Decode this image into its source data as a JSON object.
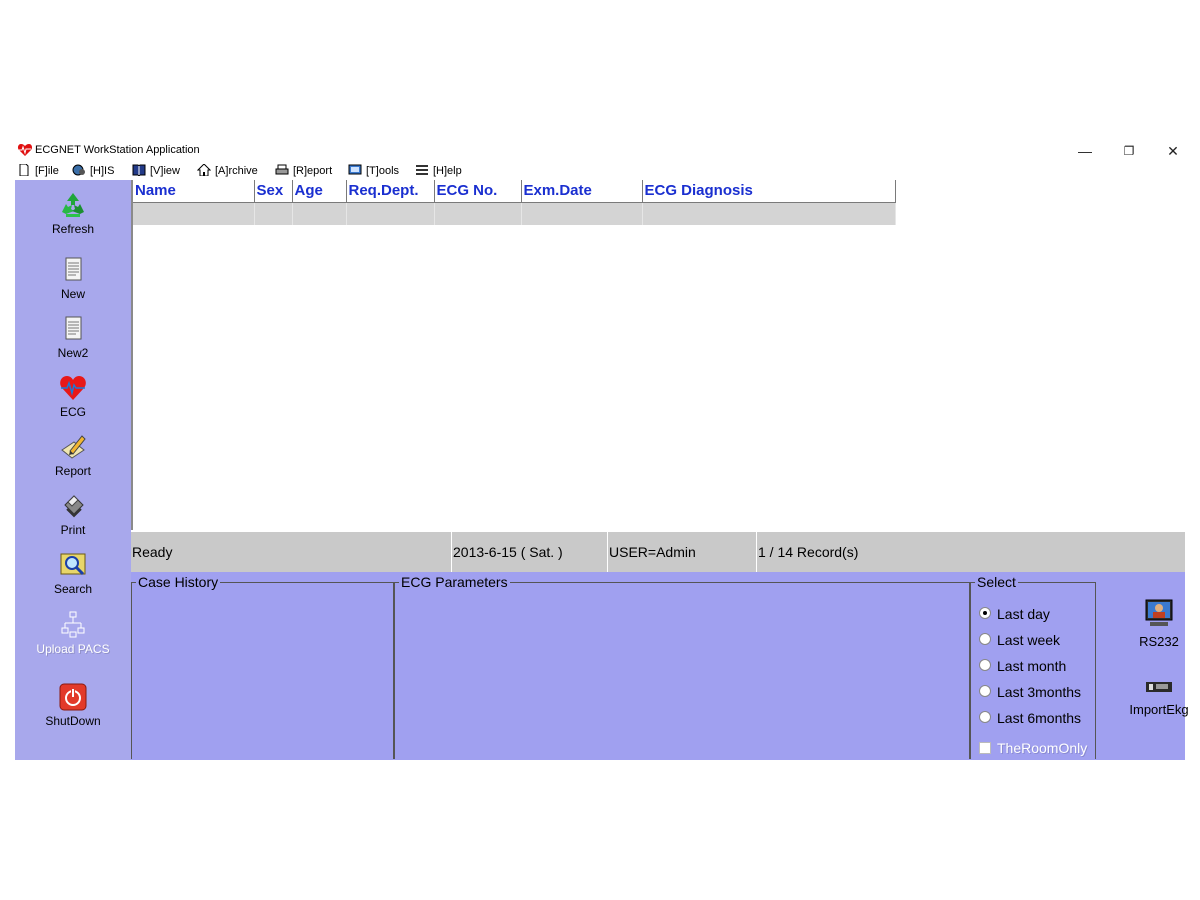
{
  "window": {
    "title": "ECGNET WorkStation Application",
    "controls": {
      "minimize": "—",
      "restore": "❐",
      "close": "✕"
    }
  },
  "menu": [
    {
      "label": "[F]ile",
      "icon": "file-icon"
    },
    {
      "label": "[H]IS",
      "icon": "globe-icon"
    },
    {
      "label": "[V]iew",
      "icon": "book-icon"
    },
    {
      "label": "[A]rchive",
      "icon": "house-icon"
    },
    {
      "label": "[R]eport",
      "icon": "printer-icon"
    },
    {
      "label": "[T]ools",
      "icon": "monitor-icon"
    },
    {
      "label": "[H]elp",
      "icon": "list-icon"
    }
  ],
  "sidebar": [
    {
      "label": "Refresh",
      "icon": "recycle-icon",
      "enabled": true
    },
    {
      "label": "New",
      "icon": "document-icon",
      "enabled": true
    },
    {
      "label": "New2",
      "icon": "document-icon",
      "enabled": true
    },
    {
      "label": "ECG",
      "icon": "heart-ecg-icon",
      "enabled": true
    },
    {
      "label": "Report",
      "icon": "pencil-paper-icon",
      "enabled": true
    },
    {
      "label": "Print",
      "icon": "printer-icon",
      "enabled": true
    },
    {
      "label": "Search",
      "icon": "magnifier-icon",
      "enabled": true
    },
    {
      "label": "Upload PACS",
      "icon": "network-icon",
      "enabled": false
    },
    {
      "label": "ShutDown",
      "icon": "power-icon",
      "enabled": true
    }
  ],
  "table": {
    "columns": [
      "Name",
      "Sex",
      "Age",
      "Req.Dept.",
      "ECG No.",
      "Exm.Date",
      "ECG Diagnosis"
    ],
    "rows": [
      [
        "",
        "",
        "",
        "",
        "",
        "",
        ""
      ]
    ]
  },
  "status": {
    "state": "Ready",
    "date": "2013-6-15 ( Sat. )",
    "user": "USER=Admin",
    "records": "1 / 14 Record(s)"
  },
  "panels": {
    "case_history": "Case History",
    "ecg_parameters": "ECG Parameters",
    "select": {
      "legend": "Select",
      "options": [
        "Last day",
        "Last week",
        "Last month",
        "Last 3months",
        "Last 6months"
      ],
      "selected": "Last day",
      "room_only": {
        "label": "TheRoomOnly",
        "checked": false,
        "enabled": false
      }
    }
  },
  "right_buttons": [
    {
      "label": "RS232",
      "icon": "computer-user-icon"
    },
    {
      "label": "ImportEkg",
      "icon": "card-reader-icon"
    }
  ],
  "colors": {
    "sidebar_bg": "#a8a8ec",
    "panel_bg": "#a0a0f0",
    "header_text": "#1a2fd0",
    "status_bg": "#c9c9c9",
    "row_bg": "#d4d4d4"
  }
}
